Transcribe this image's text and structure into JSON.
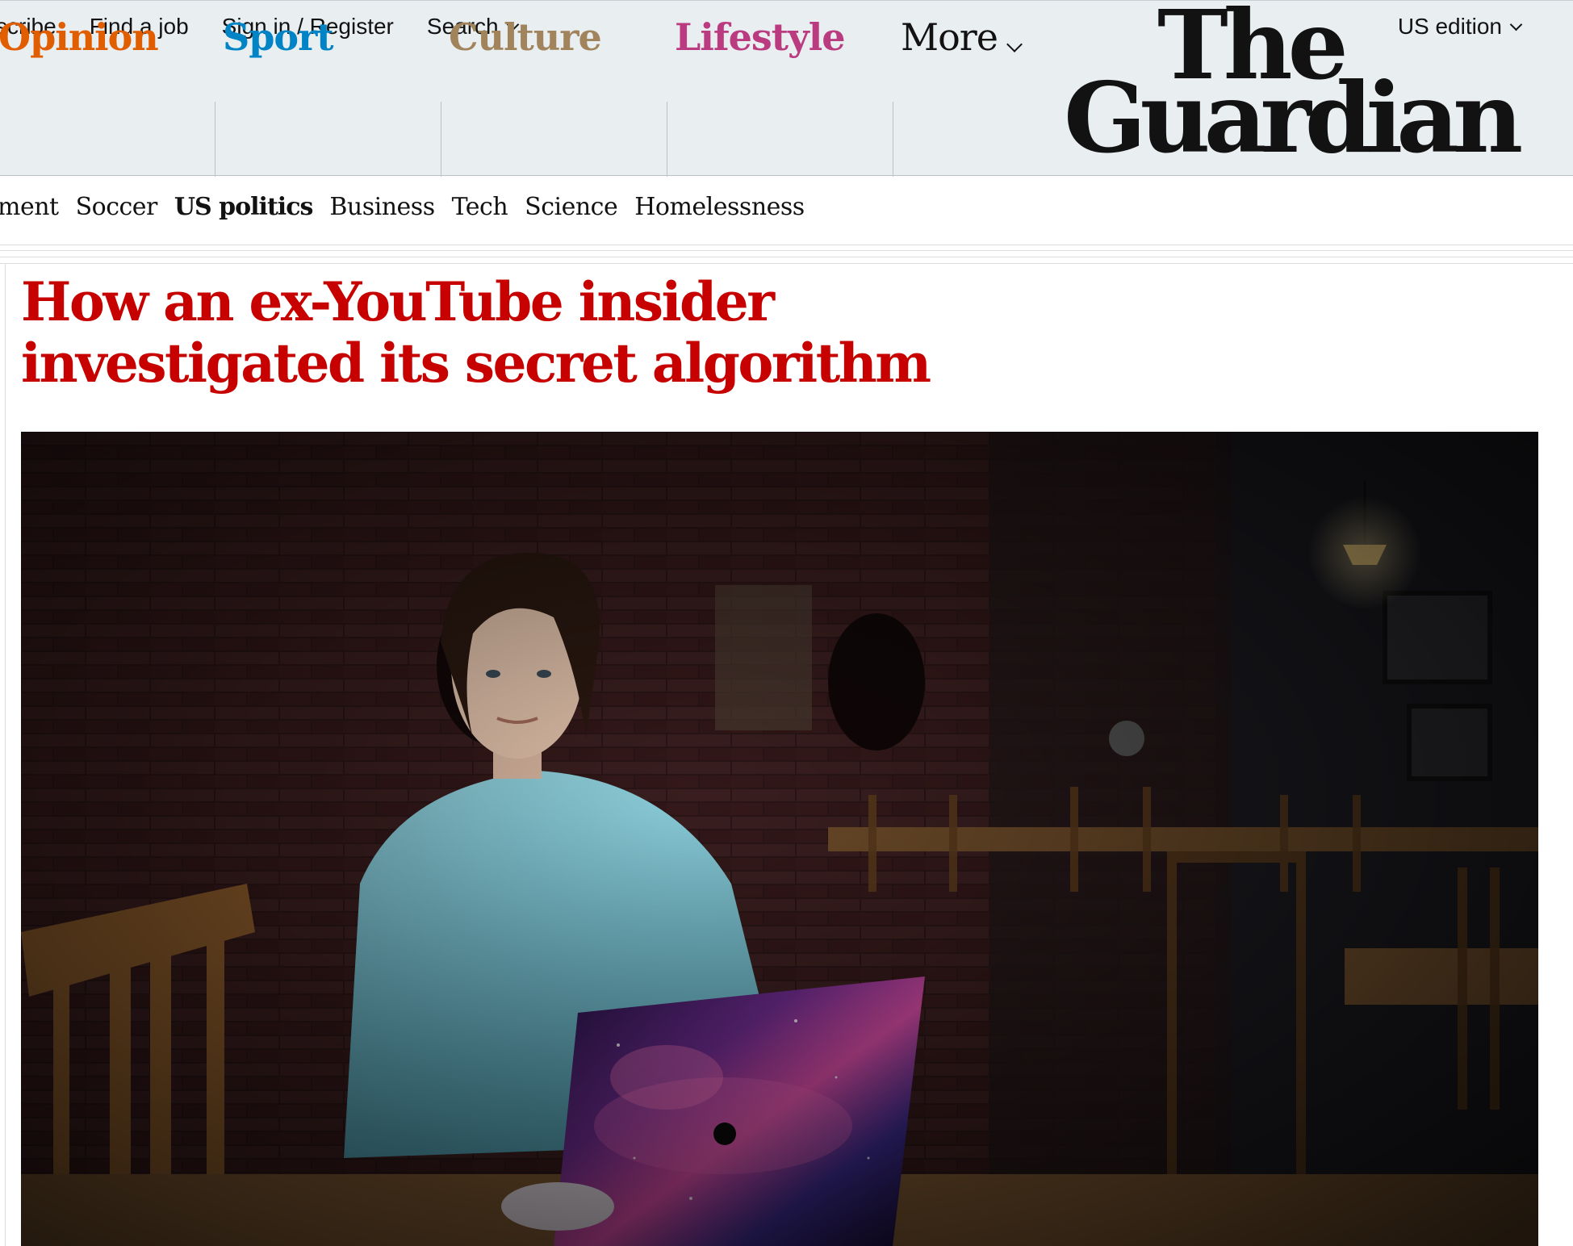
{
  "topbar": {
    "links": [
      "scribe",
      "Find a job",
      "Sign in / Register",
      "Search"
    ],
    "edition": "US edition"
  },
  "pillars": [
    {
      "label": "Opinion",
      "color": "#e05e00"
    },
    {
      "label": "Sport",
      "color": "#0084c6"
    },
    {
      "label": "Culture",
      "color": "#a1845c"
    },
    {
      "label": "Lifestyle",
      "color": "#bb3b80"
    },
    {
      "label": "More",
      "color": "#121212"
    }
  ],
  "logo": {
    "line1": "The",
    "line2": "Guardian"
  },
  "subnav": [
    "ment",
    "Soccer",
    "US politics",
    "Business",
    "Tech",
    "Science",
    "Homelessness"
  ],
  "article": {
    "headline_line1": "How an ex-YouTube insider",
    "headline_line2": "investigated its secret algorithm"
  },
  "hero_image": {
    "subject": "person-at-laptop-in-cafe"
  }
}
